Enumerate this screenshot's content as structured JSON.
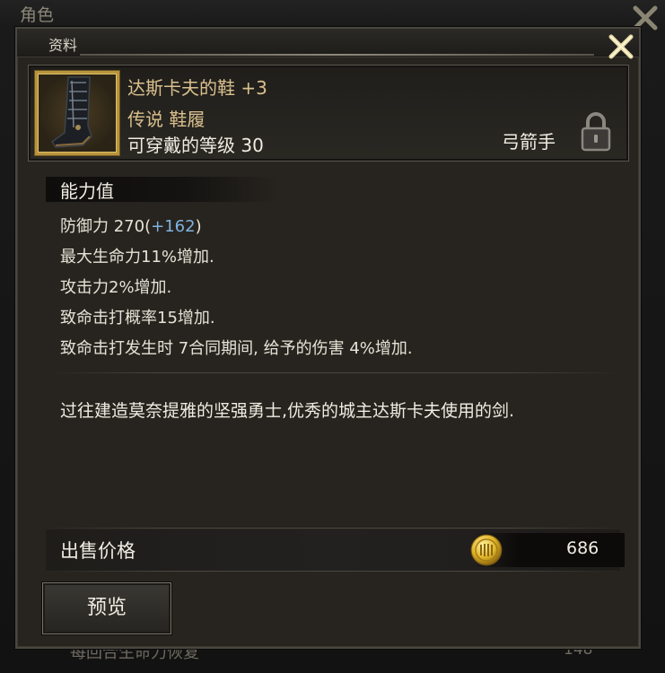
{
  "background_window": {
    "title": "角色",
    "footer_text": "每回合生命力恢复",
    "footer_value": "148"
  },
  "dialog": {
    "title": "资料"
  },
  "item": {
    "name": "达斯卡夫的鞋",
    "enhance": "+3",
    "type": "传说 鞋履",
    "level_req": "可穿戴的等级 30",
    "class": "弓箭手",
    "icon": "boot-icon"
  },
  "stats": {
    "title": "能力值",
    "defense_label": "防御力 270(",
    "defense_bonus": "+162",
    "defense_close": ")",
    "lines": [
      "最大生命力11%增加.",
      "攻击力2%增加.",
      "致命击打概率15增加.",
      "致命击打发生时 7合同期间, 给予的伤害 4%增加."
    ]
  },
  "description": "过往建造莫奈提雅的坚强勇士,优秀的城主达斯卡夫使用的剑.",
  "sell": {
    "label": "出售价格",
    "price": "686",
    "currency_icon": "gold-coin-icon"
  },
  "buttons": {
    "preview": "预览"
  },
  "colors": {
    "item_name": "#d9c08e",
    "bonus": "#7fb3e0",
    "border_gold": "#b8943d"
  }
}
